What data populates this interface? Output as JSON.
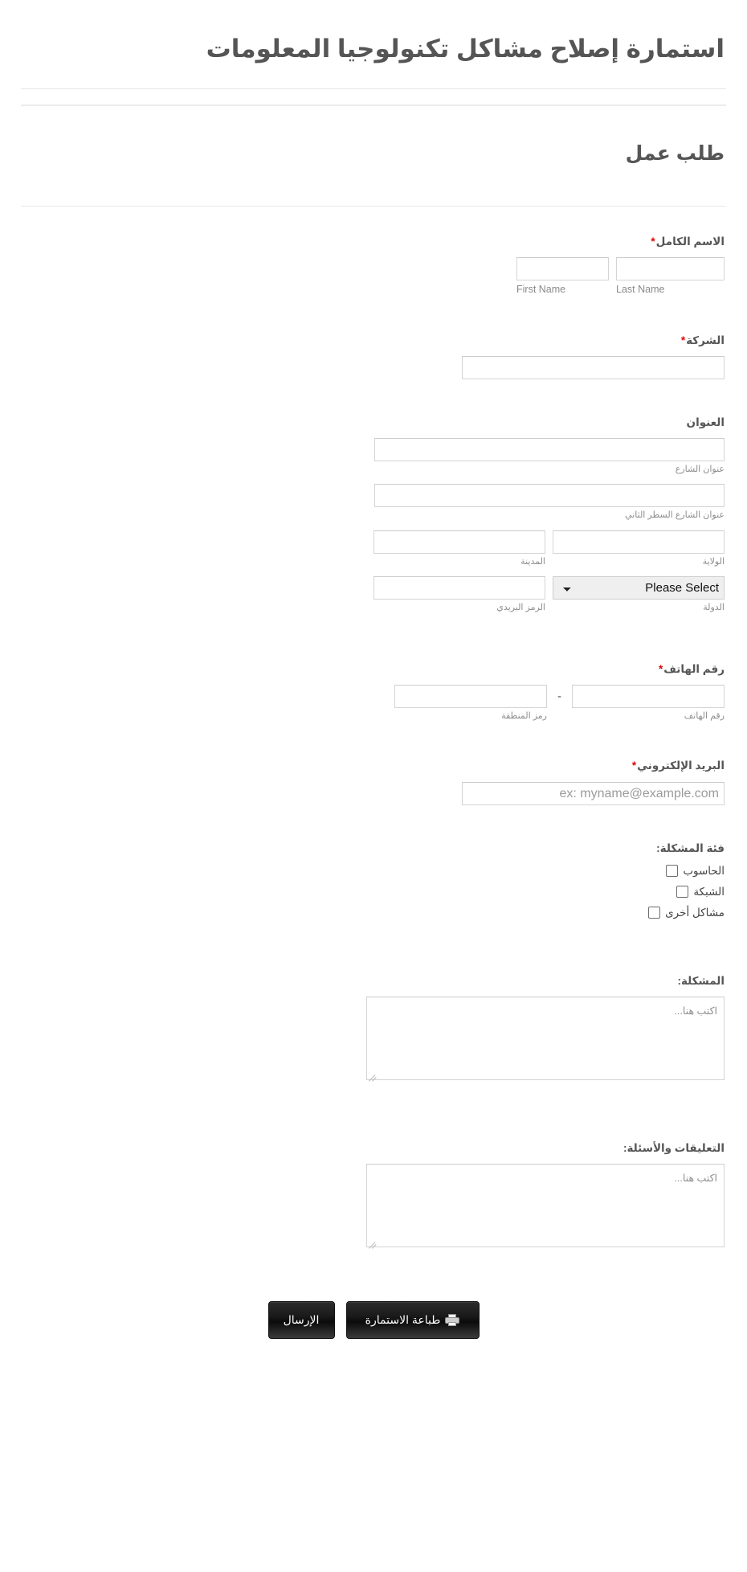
{
  "header": {
    "title": "استمارة إصلاح مشاكل تكنولوجيا المعلومات",
    "section_heading": "طلب عمل"
  },
  "fields": {
    "full_name": {
      "label": "الاسم الكامل",
      "required_marker": "*",
      "sub_first": "First Name",
      "sub_last": "Last Name",
      "first_value": "",
      "last_value": ""
    },
    "company": {
      "label": "الشركة",
      "required_marker": "*",
      "value": ""
    },
    "address": {
      "label": "العنوان",
      "street_sub": "عنوان الشارع",
      "street2_sub": "عنوان الشارع السطر الثاني",
      "city_sub": "المدينة",
      "state_sub": "الولاية",
      "postal_sub": "الرمز البريدي",
      "country_sub": "الدولة",
      "country_selected": "Please Select",
      "street_value": "",
      "street2_value": "",
      "city_value": "",
      "state_value": "",
      "postal_value": ""
    },
    "phone": {
      "label": "رقم الهاتف",
      "required_marker": "*",
      "area_sub": "رمز المنطقة",
      "number_sub": "رقم الهاتف",
      "separator": "-",
      "area_value": "",
      "number_value": ""
    },
    "email": {
      "label": "البريد الإلكتروني",
      "required_marker": "*",
      "placeholder": "ex: myname@example.com",
      "value": ""
    },
    "problem_category": {
      "label": "فئة المشكلة:",
      "options": [
        {
          "label": "الحاسوب",
          "checked": false
        },
        {
          "label": "الشبكة",
          "checked": false
        },
        {
          "label": "مشاكل أخرى",
          "checked": false
        }
      ]
    },
    "problem": {
      "label": "المشكلة:",
      "placeholder": "اكتب هنا...",
      "value": ""
    },
    "comments": {
      "label": "التعليقات والأسئلة:",
      "placeholder": "اكتب هنا...",
      "value": ""
    }
  },
  "footer": {
    "submit_label": "الإرسال",
    "print_label": "طباعة الاستمارة",
    "print_icon": "printer-icon"
  },
  "colors": {
    "required_star": "#e00000",
    "heading_text": "#555555",
    "body_text": "#444444",
    "sub_label": "#8d8d8d",
    "input_border": "#d4d4d4",
    "button_bg": "#141414",
    "page_bg": "#ffffff"
  }
}
